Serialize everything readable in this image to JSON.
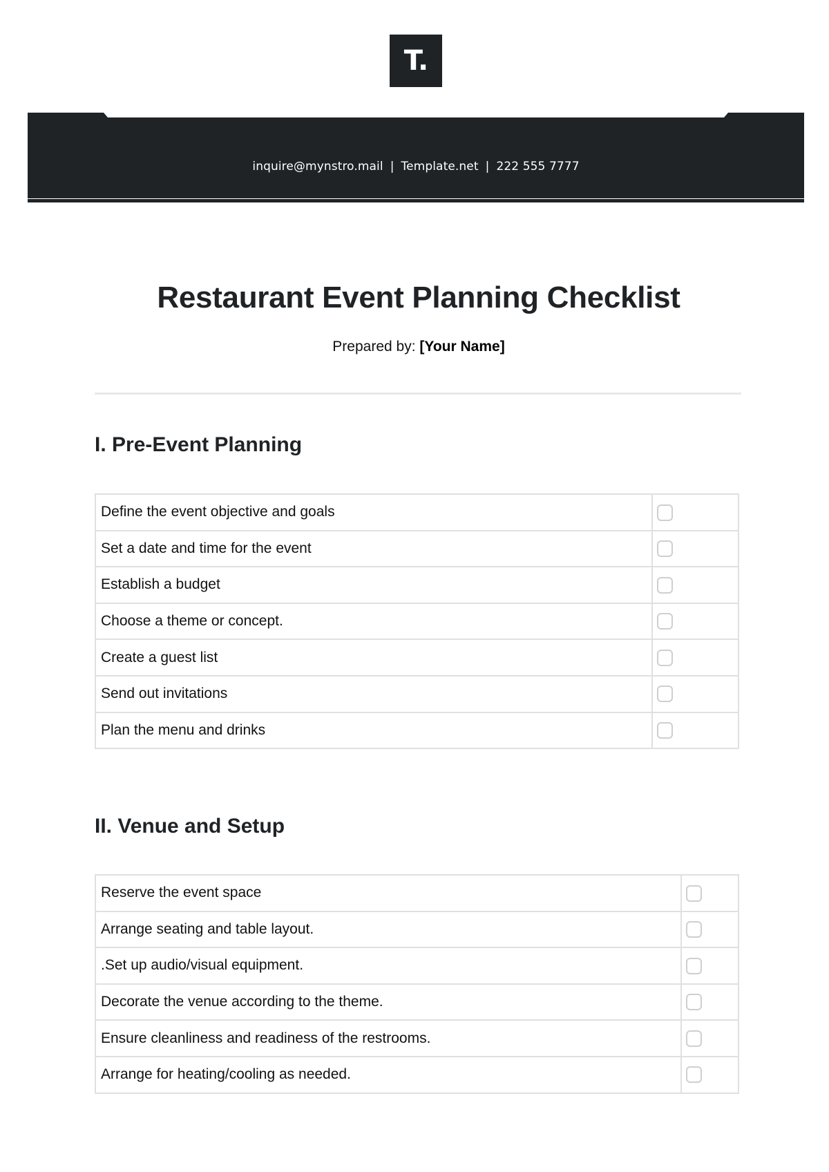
{
  "logo": {
    "text": "T.",
    "icon": "brand-logo"
  },
  "header": {
    "email": "inquire@mynstro.mail",
    "website": "Template.net",
    "phone": "222 555 7777",
    "separator": "|",
    "band_color": "#202326"
  },
  "document": {
    "title": "Restaurant Event Planning Checklist",
    "prepared_by_label": "Prepared by:",
    "prepared_by_value": "[Your Name]"
  },
  "sections": [
    {
      "heading": "I. Pre-Event Planning",
      "items": [
        {
          "task": "Define the event objective and goals",
          "checked": false
        },
        {
          "task": "Set a date and time for the event",
          "checked": false
        },
        {
          "task": "Establish a budget",
          "checked": false
        },
        {
          "task": "Choose a theme or concept.",
          "checked": false
        },
        {
          "task": "Create a guest list",
          "checked": false
        },
        {
          "task": "Send out invitations",
          "checked": false
        },
        {
          "task": "Plan the menu and drinks",
          "checked": false
        }
      ]
    },
    {
      "heading": "II. Venue and Setup",
      "items": [
        {
          "task": "Reserve the event space",
          "checked": false
        },
        {
          "task": "Arrange seating and table layout.",
          "checked": false
        },
        {
          "task": ".Set up audio/visual equipment.",
          "checked": false
        },
        {
          "task": "Decorate the venue according to the theme.",
          "checked": false
        },
        {
          "task": "Ensure cleanliness and readiness of the restrooms.",
          "checked": false
        },
        {
          "task": "Arrange for heating/cooling as needed.",
          "checked": false
        }
      ]
    }
  ]
}
